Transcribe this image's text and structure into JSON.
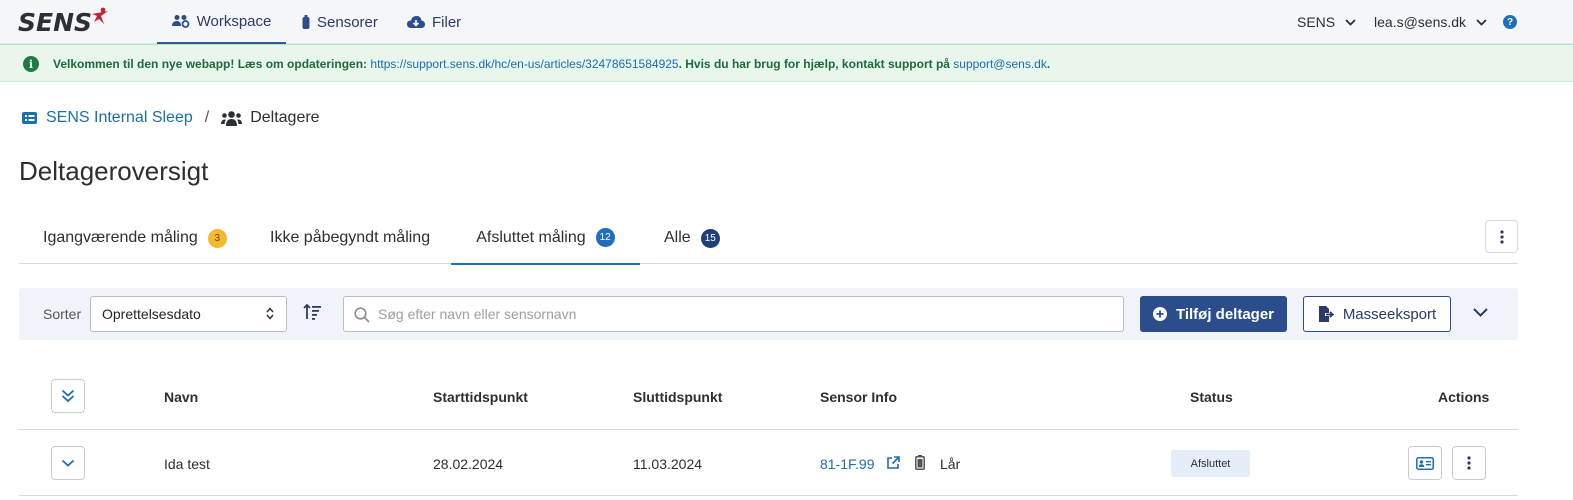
{
  "nav": {
    "logo": "SENS",
    "items": [
      {
        "label": "Workspace",
        "icon": "users-gear-icon",
        "active": true
      },
      {
        "label": "Sensorer",
        "icon": "sensor-icon"
      },
      {
        "label": "Filer",
        "icon": "cloud-download-icon"
      }
    ],
    "org": "SENS",
    "user": "lea.s@sens.dk",
    "help": "?"
  },
  "alert": {
    "text_1": "Velkommen til den nye webapp! Læs om opdateringen: ",
    "link": "https://support.sens.dk/hc/en-us/articles/32478651584925",
    "text_2": ". Hvis du har brug for hjælp, kontakt support på ",
    "email": "support@sens.dk",
    "text_3": "."
  },
  "breadcrumb": {
    "project": "SENS Internal Sleep",
    "separator": "/",
    "current": "Deltagere"
  },
  "page_title": "Deltageroversigt",
  "tabs": [
    {
      "label": "Igangværende måling",
      "count": "3"
    },
    {
      "label": "Ikke påbegyndt måling"
    },
    {
      "label": "Afsluttet måling",
      "count": "12",
      "active": true
    },
    {
      "label": "Alle",
      "count": "15"
    }
  ],
  "toolbar": {
    "sort_label": "Sorter",
    "sort_value": "Oprettelsesdato",
    "search_placeholder": "Søg efter navn eller sensornavn",
    "add_label": "Tilføj deltager",
    "export_label": "Masseeksport"
  },
  "table": {
    "columns": [
      "Navn",
      "Starttidspunkt",
      "Sluttidspunkt",
      "Sensor Info",
      "Status",
      "Actions"
    ],
    "rows": [
      {
        "name": "Ida test",
        "start": "28.02.2024",
        "end": "11.03.2024",
        "sensor": "81-1F.99",
        "placement": "Lår",
        "status": "Afsluttet"
      }
    ]
  },
  "colors": {
    "primary": "#2b4d8c",
    "link": "#1a6fb0",
    "alert_bg": "#e8f6ec",
    "toolbar_bg": "#f0f4fa",
    "badge_yellow": "#f5b82e"
  }
}
